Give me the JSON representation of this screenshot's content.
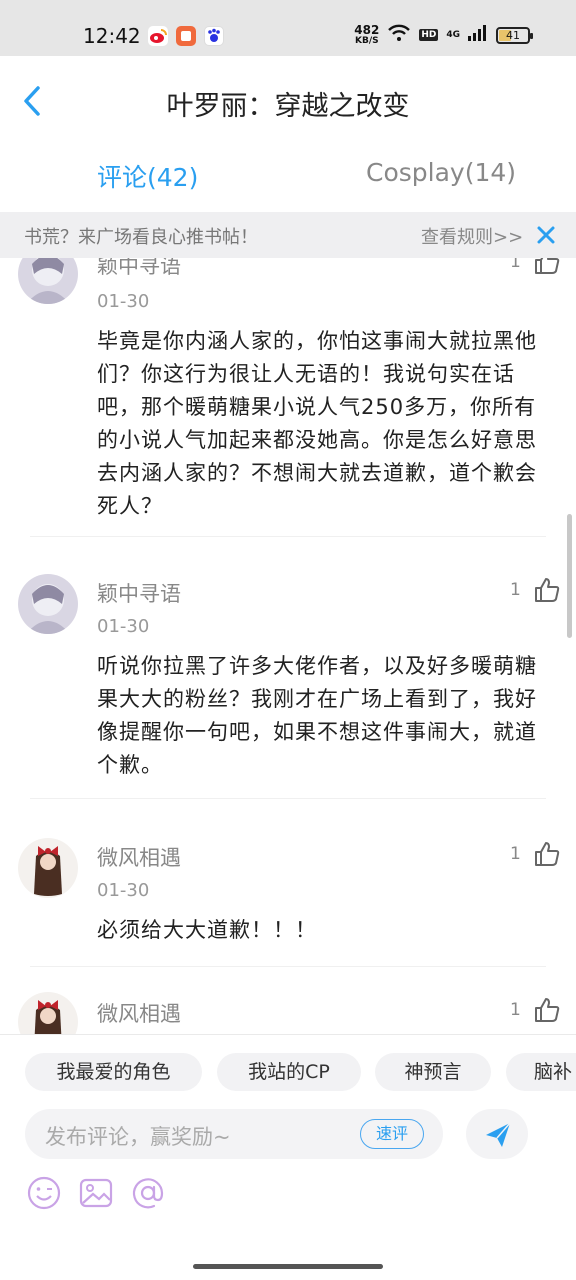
{
  "status_bar": {
    "time": "12:42",
    "net_speed_value": "482",
    "net_speed_unit": "KB/S",
    "hd": "HD",
    "signal": "4G",
    "battery": "41",
    "battery_level_percent": 41
  },
  "header": {
    "title": "叶罗丽：穿越之改变"
  },
  "tabs": [
    {
      "label": "评论(42)",
      "active": true
    },
    {
      "label": "Cosplay(14)",
      "active": false
    }
  ],
  "notice": {
    "text": "书荒？来广场看良心推书帖！",
    "link": "查看规则>>"
  },
  "comments": [
    {
      "user": "颖中寻语",
      "date": "01-30",
      "likes": "1",
      "text": "毕竟是你内涵人家的，你怕这事闹大就拉黑他们？你这行为很让人无语的！我说句实在话吧，那个暖萌糖果小说人气250多万，你所有的小说人气加起来都没她高。你是怎么好意思去内涵人家的？不想闹大就去道歉，道个歉会死人？"
    },
    {
      "user": "颖中寻语",
      "date": "01-30",
      "likes": "1",
      "text": "听说你拉黑了许多大佬作者，以及好多暖萌糖果大大的粉丝？我刚才在广场上看到了，我好像提醒你一句吧，如果不想这件事闹大，就道个歉。"
    },
    {
      "user": "微风相遇",
      "date": "01-30",
      "likes": "1",
      "text": "必须给大大道歉！！！"
    },
    {
      "user": "微风相遇",
      "date": "",
      "likes": "1",
      "text": ""
    }
  ],
  "bottom": {
    "chips": [
      "我最爱的角色",
      "我站的CP",
      "神预言",
      "脑补"
    ],
    "input_placeholder": "发布评论，赢奖励~",
    "quick_review": "速评"
  },
  "colors": {
    "accent": "#2a9ff0",
    "status_bar_bg": "#e6e6e6",
    "notice_bg": "#efeff1",
    "tool_icon": "#c9a3e6"
  }
}
